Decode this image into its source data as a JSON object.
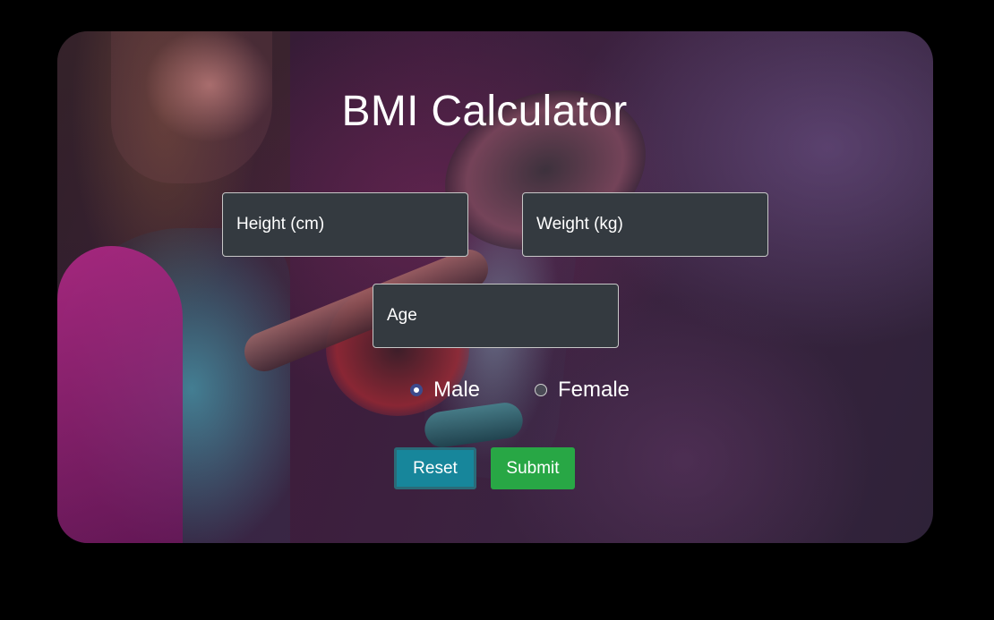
{
  "app": {
    "title": "BMI Calculator"
  },
  "form": {
    "height": {
      "placeholder": "Height (cm)",
      "value": ""
    },
    "weight": {
      "placeholder": "Weight (kg)",
      "value": ""
    },
    "age": {
      "placeholder": "Age",
      "value": ""
    },
    "gender": {
      "options": [
        {
          "label": "Male",
          "selected": true
        },
        {
          "label": "Female",
          "selected": false
        }
      ]
    },
    "reset_label": "Reset",
    "submit_label": "Submit"
  },
  "colors": {
    "page_background": "#000000",
    "input_background": "#343a40",
    "reset_button": "#17869b",
    "submit_button": "#28a745",
    "text": "#ffffff"
  }
}
